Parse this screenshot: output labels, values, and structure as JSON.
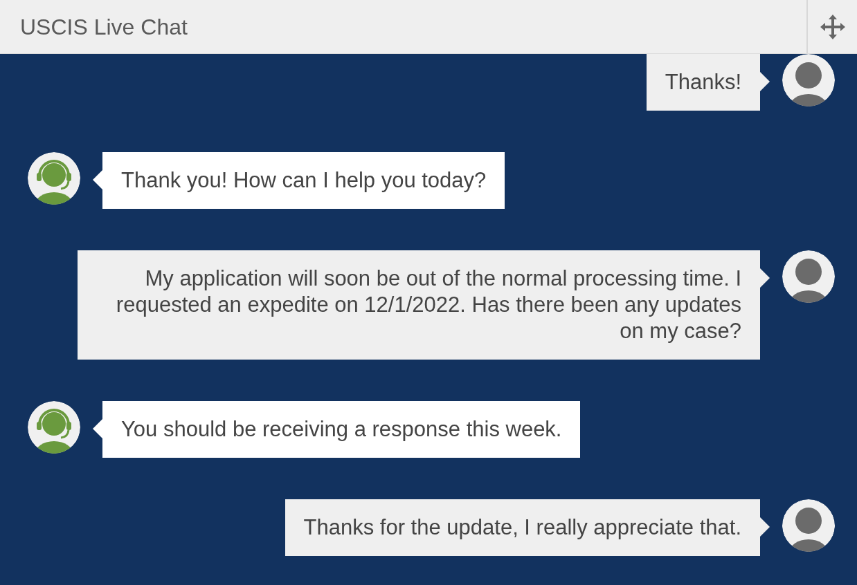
{
  "window": {
    "title": "USCIS Live Chat"
  },
  "messages": [
    {
      "kind": "user",
      "text": "Thanks!"
    },
    {
      "kind": "agent",
      "text": "Thank you! How can I help you today?"
    },
    {
      "kind": "user",
      "text": "My application will soon be out of the normal processing time. I requested an expedite on 12/1/2022. Has there been any updates on my case?"
    },
    {
      "kind": "agent",
      "text": "You should be receiving a response this week."
    },
    {
      "kind": "user",
      "text": "Thanks for the update, I really appreciate that."
    }
  ]
}
